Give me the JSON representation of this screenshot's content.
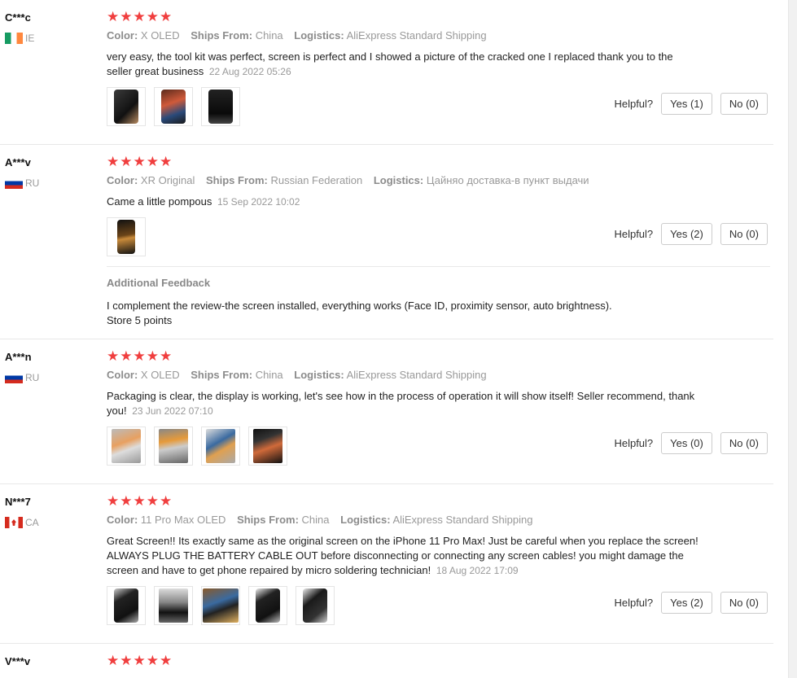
{
  "labels": {
    "color": "Color:",
    "ships_from": "Ships From:",
    "logistics": "Logistics:",
    "helpful": "Helpful?",
    "additional_feedback": "Additional Feedback"
  },
  "icons": {
    "star": "star-icon",
    "flag": "flag-icon",
    "photo": "photo-thumbnail"
  },
  "colors": {
    "star": "#f03e3e",
    "muted": "#999999",
    "border": "#e8e8e8"
  },
  "reviews": [
    {
      "user": "C***c",
      "country": "IE",
      "rating": 5,
      "color": "X OLED",
      "ships_from": "China",
      "logistics": "AliExpress Standard Shipping",
      "text": "very easy, the tool kit was perfect, screen is perfect and I showed a picture of the cracked one I replaced thank you to the seller great business",
      "date": "22 Aug 2022 05:26",
      "yes": "Yes (1)",
      "no": "No (0)"
    },
    {
      "user": "A***v",
      "country": "RU",
      "rating": 5,
      "color": "XR Original",
      "ships_from": "Russian Federation",
      "logistics": "Цайняо доставка-в пункт выдачи",
      "text": "Came a little pompous",
      "date": "15 Sep 2022 10:02",
      "yes": "Yes (2)",
      "no": "No (0)",
      "additional_text_1": "I complement the review-the screen installed, everything works (Face ID, proximity sensor, auto brightness).",
      "additional_text_2": "Store 5 points"
    },
    {
      "user": "A***n",
      "country": "RU",
      "rating": 5,
      "color": "X OLED",
      "ships_from": "China",
      "logistics": "AliExpress Standard Shipping",
      "text": "Packaging is clear, the display is working, let's see how in the process of operation it will show itself! Seller recommend, thank you!",
      "date": "23 Jun 2022 07:10",
      "yes": "Yes (0)",
      "no": "No (0)"
    },
    {
      "user": "N***7",
      "country": "CA",
      "rating": 5,
      "color": "11 Pro Max OLED",
      "ships_from": "China",
      "logistics": "AliExpress Standard Shipping",
      "text": "Great Screen!! Its exactly same as the original screen on the iPhone 11 Pro Max! Just be careful when you replace the screen! ALWAYS PLUG THE BATTERY CABLE OUT before disconnecting or connecting any screen cables! you might damage the screen and have to get phone repaired by micro soldering technician!",
      "date": "18 Aug 2022 17:09",
      "yes": "Yes (2)",
      "no": "No (0)"
    },
    {
      "user": "V***v",
      "rating": 5
    }
  ]
}
